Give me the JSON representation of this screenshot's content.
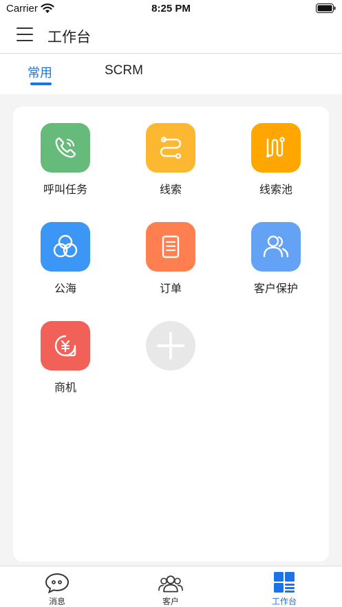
{
  "status_bar": {
    "carrier": "Carrier",
    "time": "8:25 PM"
  },
  "nav": {
    "title": "工作台",
    "menu_icon": "hamburger-menu-icon"
  },
  "tabs": [
    {
      "label": "常用",
      "active": true
    },
    {
      "label": "SCRM",
      "active": false
    }
  ],
  "grid": {
    "items": [
      {
        "label": "呼叫任务",
        "icon": "phone-call-icon",
        "color": "#66bb7a"
      },
      {
        "label": "线索",
        "icon": "route-link-icon",
        "color": "#fbb830"
      },
      {
        "label": "线索池",
        "icon": "lead-pool-icon",
        "color": "#ffa600"
      },
      {
        "label": "公海",
        "icon": "sea-swirl-icon",
        "color": "#3c96f5"
      },
      {
        "label": "订单",
        "icon": "order-document-icon",
        "color": "#ff7f50"
      },
      {
        "label": "客户保护",
        "icon": "customer-users-icon",
        "color": "#64a2f5"
      },
      {
        "label": "商机",
        "icon": "yuan-opportunity-icon",
        "color": "#f26157"
      }
    ],
    "add_icon": "add-plus-icon"
  },
  "tab_bar": [
    {
      "label": "消息",
      "icon": "message-chat-icon",
      "active": false
    },
    {
      "label": "客户",
      "icon": "customers-icon",
      "active": false
    },
    {
      "label": "工作台",
      "icon": "workbench-grid-icon",
      "active": true
    }
  ],
  "colors": {
    "accent": "#1a73e8",
    "background": "#f4f4f4"
  }
}
